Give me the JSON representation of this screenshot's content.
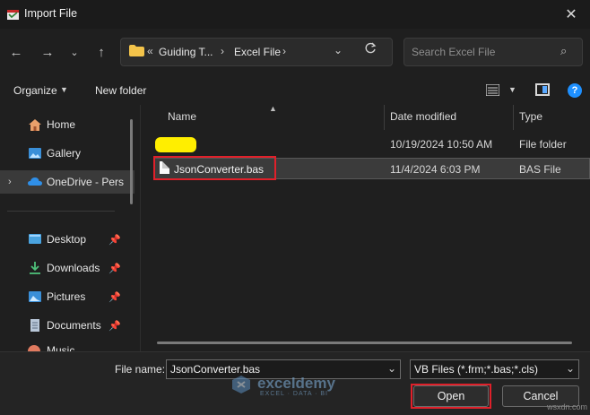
{
  "window": {
    "title": "Import File"
  },
  "address": {
    "prev": "«",
    "crumbs": [
      "Guiding T...",
      "Excel File"
    ],
    "sep": "›"
  },
  "search": {
    "placeholder": "Search Excel File"
  },
  "toolbar": {
    "organize": "Organize",
    "new_folder": "New folder"
  },
  "nav": {
    "items": [
      {
        "label": "Home",
        "icon": "home-icon",
        "pinned": false
      },
      {
        "label": "Gallery",
        "icon": "gallery-icon",
        "pinned": false
      },
      {
        "label": "OneDrive - Perso",
        "icon": "cloud-icon",
        "pinned": false,
        "selected": true
      },
      {
        "label": "Desktop",
        "icon": "desktop-icon",
        "pinned": true
      },
      {
        "label": "Downloads",
        "icon": "download-icon",
        "pinned": true
      },
      {
        "label": "Pictures",
        "icon": "pictures-icon",
        "pinned": true
      },
      {
        "label": "Documents",
        "icon": "documents-icon",
        "pinned": true
      },
      {
        "label": "Music",
        "icon": "music-icon",
        "pinned": true
      }
    ]
  },
  "files": {
    "columns": [
      "Name",
      "Date modified",
      "Type"
    ],
    "rows": [
      {
        "name": "",
        "date": "10/19/2024 10:50 AM",
        "type": "File folder",
        "icon": "folder-icon"
      },
      {
        "name": "JsonConverter.bas",
        "date": "11/4/2024 6:03 PM",
        "type": "BAS File",
        "icon": "file-icon",
        "selected": true
      }
    ]
  },
  "bottom": {
    "file_name_label": "File name:",
    "file_name_value": "JsonConverter.bas",
    "file_type_value": "VB Files (*.frm;*.bas;*.cls)",
    "open_label": "Open",
    "cancel_label": "Cancel"
  },
  "watermark": {
    "name": "exceldemy",
    "tagline": "EXCEL · DATA · BI"
  },
  "corner_text": "wsxdn.com",
  "colors": {
    "accent": "#1e90ff",
    "highlight": "#e0202a",
    "redacted": "#ffee00"
  }
}
